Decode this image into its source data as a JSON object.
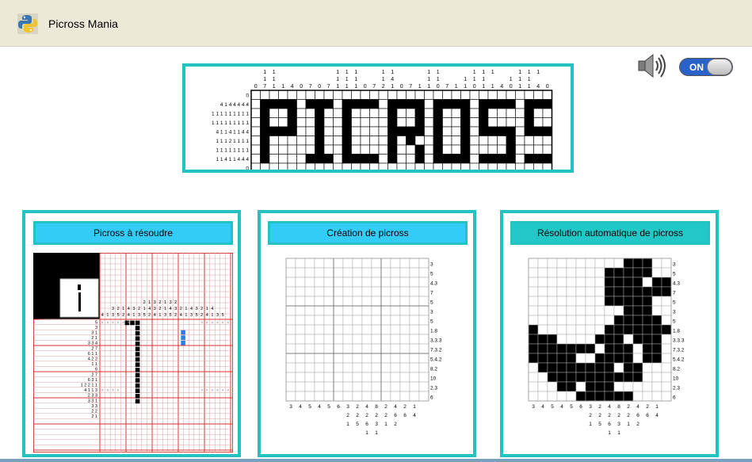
{
  "window": {
    "title": "Picross Mania"
  },
  "sound": {
    "toggle_label": "ON",
    "state": true
  },
  "panels": [
    {
      "label": "Picross à résoudre",
      "active": false
    },
    {
      "label": "Création de picross",
      "active": false
    },
    {
      "label": "Résolution automatique de picross",
      "active": true
    }
  ],
  "logo": {
    "col_clues_top": [
      "",
      "1",
      "1",
      "",
      "",
      "",
      "",
      "",
      "",
      "1",
      "1",
      "1",
      "",
      "",
      "1",
      "1",
      "",
      "",
      "",
      "1",
      "1",
      "",
      "",
      "",
      "1",
      "1",
      "1",
      "",
      "",
      "1",
      "1",
      "1",
      ""
    ],
    "col_clues_mid": [
      "",
      "1",
      "1",
      "",
      "",
      "",
      "",
      "",
      "",
      "1",
      "1",
      "1",
      "",
      "",
      "1",
      "4",
      "",
      "",
      "",
      "1",
      "1",
      "",
      "",
      "1",
      "1",
      "1",
      "",
      "",
      "1",
      "1",
      "1",
      "",
      ""
    ],
    "col_clues_bot": [
      "0",
      "7",
      "1",
      "1",
      "4",
      "0",
      "7",
      "0",
      "7",
      "1",
      "1",
      "1",
      "0",
      "7",
      "2",
      "1",
      "0",
      "7",
      "1",
      "1",
      "0",
      "7",
      "1",
      "1",
      "0",
      "1",
      "1",
      "4",
      "0",
      "1",
      "1",
      "4",
      "0"
    ],
    "row_clues": [
      "0",
      "4 1 4 4 4 4 4",
      "1 1 1 1 1 1 1 1 1",
      "1 1 1 1 1 1 1 1 1",
      "4 1 1 4 1 1 4 4",
      "1 1 1 2 1 1 1 1",
      "1 1 1 1 1 1 1 1",
      "1 1 4 1 1 4 4 4",
      "0"
    ]
  },
  "panel1": {
    "clue_rows": [
      "5",
      "3",
      "3 1",
      "2 1",
      "3 3 4",
      "2 7",
      "6 1 1",
      "4 2 2",
      "1 1",
      "6",
      "2 7",
      "6 3 1",
      "1 2 2 1 1",
      "4 1 1 3",
      "2 3 3",
      "3 3 1",
      "3 3",
      "2 2",
      "2 1"
    ]
  },
  "panel2": {
    "row_clues": [
      "3",
      "5",
      "4.3",
      "7",
      "5",
      "3",
      "5",
      "1.8",
      "3.3.3",
      "7.3.2",
      "5.4.2",
      "8.2",
      "10",
      "2.3",
      "6"
    ],
    "col_clues_1": [
      "3",
      "4",
      "5",
      "4",
      "5",
      "6",
      "3",
      "2",
      "4",
      "8",
      "2",
      "4",
      "2",
      "1"
    ],
    "col_clues_2": [
      "",
      "",
      "",
      "",
      "",
      "",
      "2",
      "2",
      "2",
      "2",
      "2",
      "6",
      "6",
      "4"
    ],
    "col_clues_3": [
      "",
      "",
      "",
      "",
      "",
      "",
      "1",
      "5",
      "6",
      "3",
      "1",
      "2",
      "",
      ""
    ],
    "col_clues_4": [
      "",
      "",
      "",
      "",
      "",
      "",
      "",
      "",
      "1",
      "1",
      "",
      "",
      "",
      ""
    ]
  },
  "panel3": {
    "row_clues": [
      "3",
      "5",
      "4.3",
      "7",
      "5",
      "3",
      "5",
      "1.8",
      "3.3.3",
      "7.3.2",
      "5.4.2",
      "8.2",
      "10",
      "2.3",
      "6"
    ],
    "col_clues_1": [
      "3",
      "4",
      "5",
      "4",
      "5",
      "6",
      "3",
      "2",
      "4",
      "8",
      "2",
      "4",
      "2",
      "1"
    ],
    "col_clues_2": [
      "",
      "",
      "",
      "",
      "",
      "",
      "2",
      "2",
      "2",
      "2",
      "2",
      "6",
      "6",
      "4"
    ],
    "col_clues_3": [
      "",
      "",
      "",
      "",
      "",
      "",
      "1",
      "5",
      "6",
      "3",
      "1",
      "2",
      "",
      ""
    ],
    "col_clues_4": [
      "",
      "",
      "",
      "",
      "",
      "",
      "",
      "",
      "1",
      "1",
      "",
      "",
      "",
      ""
    ],
    "solution": [
      "..........XXX...",
      "........XXXXX...",
      "........XXXX.XXX",
      "........XXXXXXX.",
      "........XXXXX...",
      "..........XXX...",
      ".........XXXXX..",
      "X.......XXXXXXXX",
      "XXX....XXX.XXX..",
      "XXXXXXX.XXX.XX..",
      "XXXXX..XXXX.XX..",
      ".XXXXXXXX.XX....",
      "..XXXXXXXXXX....",
      "...XX.XXX.......",
      ".....XXXXXX....."
    ]
  }
}
